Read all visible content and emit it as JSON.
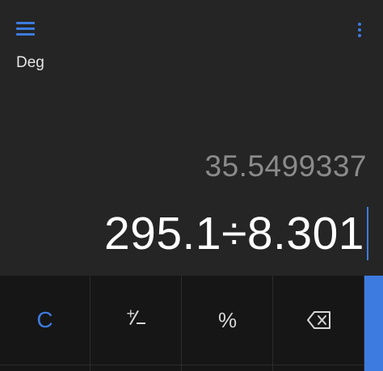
{
  "header": {
    "menu_icon": "hamburger-menu-icon",
    "more_icon": "more-vertical-icon",
    "angle_mode": "Deg"
  },
  "display": {
    "result": "35.5499337",
    "expression": "295.1÷8.301"
  },
  "keypad": {
    "clear_label": "C",
    "plusminus_icon": "plus-minus-icon",
    "percent_label": "%",
    "backspace_icon": "backspace-icon"
  },
  "colors": {
    "accent": "#3d7be0",
    "background": "#252525",
    "keypad_background": "#161616",
    "result_text": "#8a8a8a",
    "expression_text": "#ffffff"
  }
}
